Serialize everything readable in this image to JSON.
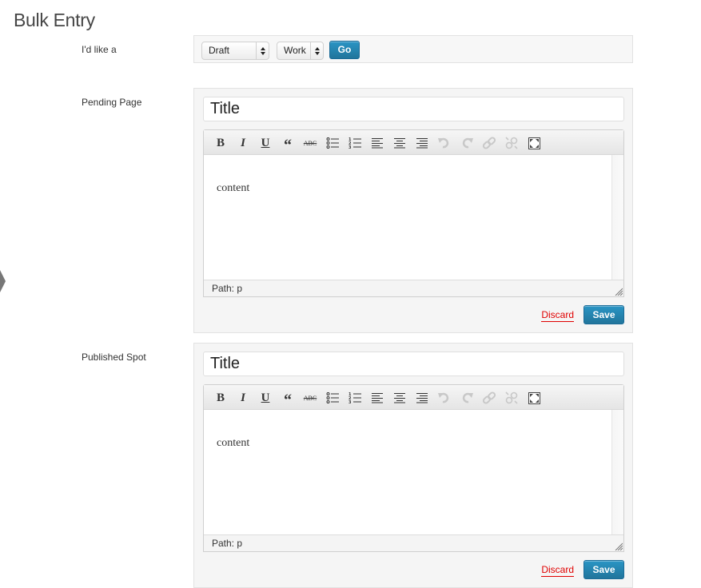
{
  "page": {
    "title": "Bulk Entry"
  },
  "creator": {
    "label": "I'd like a",
    "status_select": {
      "value": "Draft"
    },
    "type_select": {
      "value": "Work"
    },
    "go_label": "Go"
  },
  "entries": [
    {
      "label": "Pending Page",
      "title_value": "Title",
      "content": "content",
      "path": "Path: p",
      "discard_label": "Discard",
      "save_label": "Save"
    },
    {
      "label": "Published Spot",
      "title_value": "Title",
      "content": "content",
      "path": "Path: p",
      "discard_label": "Discard",
      "save_label": "Save"
    }
  ],
  "toolbar_icons": [
    "bold-icon",
    "italic-icon",
    "underline-icon",
    "blockquote-icon",
    "strikethrough-icon",
    "bullet-list-icon",
    "numbered-list-icon",
    "align-left-icon",
    "align-center-icon",
    "align-right-icon",
    "undo-icon",
    "redo-icon",
    "link-icon",
    "unlink-icon",
    "fullscreen-icon"
  ],
  "colors": {
    "primary_button": "#21759b",
    "discard_link": "#e00000"
  }
}
